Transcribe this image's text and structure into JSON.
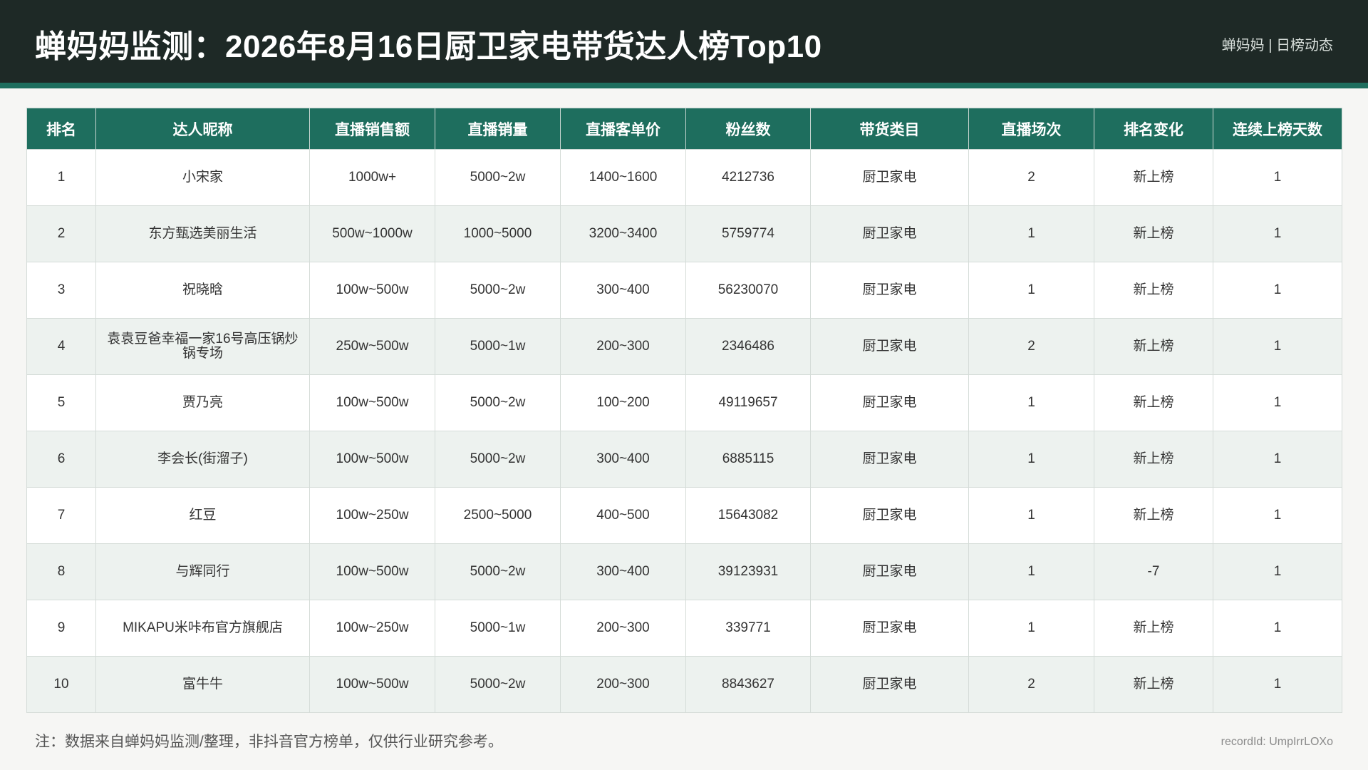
{
  "header": {
    "title": "蝉妈妈监测：2026年8月16日厨卫家电带货达人榜Top10",
    "brand": "蝉妈妈 | 日榜动态"
  },
  "table": {
    "columns": [
      "排名",
      "达人昵称",
      "直播销售额",
      "直播销量",
      "直播客单价",
      "粉丝数",
      "带货类目",
      "直播场次",
      "排名变化",
      "连续上榜天数"
    ],
    "rows": [
      [
        "1",
        "小宋家",
        "1000w+",
        "5000~2w",
        "1400~1600",
        "4212736",
        "厨卫家电",
        "2",
        "新上榜",
        "1"
      ],
      [
        "2",
        "东方甄选美丽生活",
        "500w~1000w",
        "1000~5000",
        "3200~3400",
        "5759774",
        "厨卫家电",
        "1",
        "新上榜",
        "1"
      ],
      [
        "3",
        "祝晓晗",
        "100w~500w",
        "5000~2w",
        "300~400",
        "56230070",
        "厨卫家电",
        "1",
        "新上榜",
        "1"
      ],
      [
        "4",
        "袁袁豆爸幸福一家16号高压锅炒锅专场",
        "250w~500w",
        "5000~1w",
        "200~300",
        "2346486",
        "厨卫家电",
        "2",
        "新上榜",
        "1"
      ],
      [
        "5",
        "贾乃亮",
        "100w~500w",
        "5000~2w",
        "100~200",
        "49119657",
        "厨卫家电",
        "1",
        "新上榜",
        "1"
      ],
      [
        "6",
        "李会长(街溜子)",
        "100w~500w",
        "5000~2w",
        "300~400",
        "6885115",
        "厨卫家电",
        "1",
        "新上榜",
        "1"
      ],
      [
        "7",
        "红豆",
        "100w~250w",
        "2500~5000",
        "400~500",
        "15643082",
        "厨卫家电",
        "1",
        "新上榜",
        "1"
      ],
      [
        "8",
        "与辉同行",
        "100w~500w",
        "5000~2w",
        "300~400",
        "39123931",
        "厨卫家电",
        "1",
        "-7",
        "1"
      ],
      [
        "9",
        "MIKAPU米咔布官方旗舰店",
        "100w~250w",
        "5000~1w",
        "200~300",
        "339771",
        "厨卫家电",
        "1",
        "新上榜",
        "1"
      ],
      [
        "10",
        "富牛牛",
        "100w~500w",
        "5000~2w",
        "200~300",
        "8843627",
        "厨卫家电",
        "2",
        "新上榜",
        "1"
      ]
    ]
  },
  "footer": {
    "note": "注：数据来自蝉妈妈监测/整理，非抖音官方榜单，仅供行业研究参考。",
    "record_id": "recordId: UmpIrrLOXo"
  },
  "colors": {
    "header_bg": "#1e2926",
    "accent": "#1e6e5e",
    "row_alt": "#edf2ef",
    "page_bg": "#f6f6f4",
    "border": "#d5dcd8",
    "text": "#333333"
  }
}
